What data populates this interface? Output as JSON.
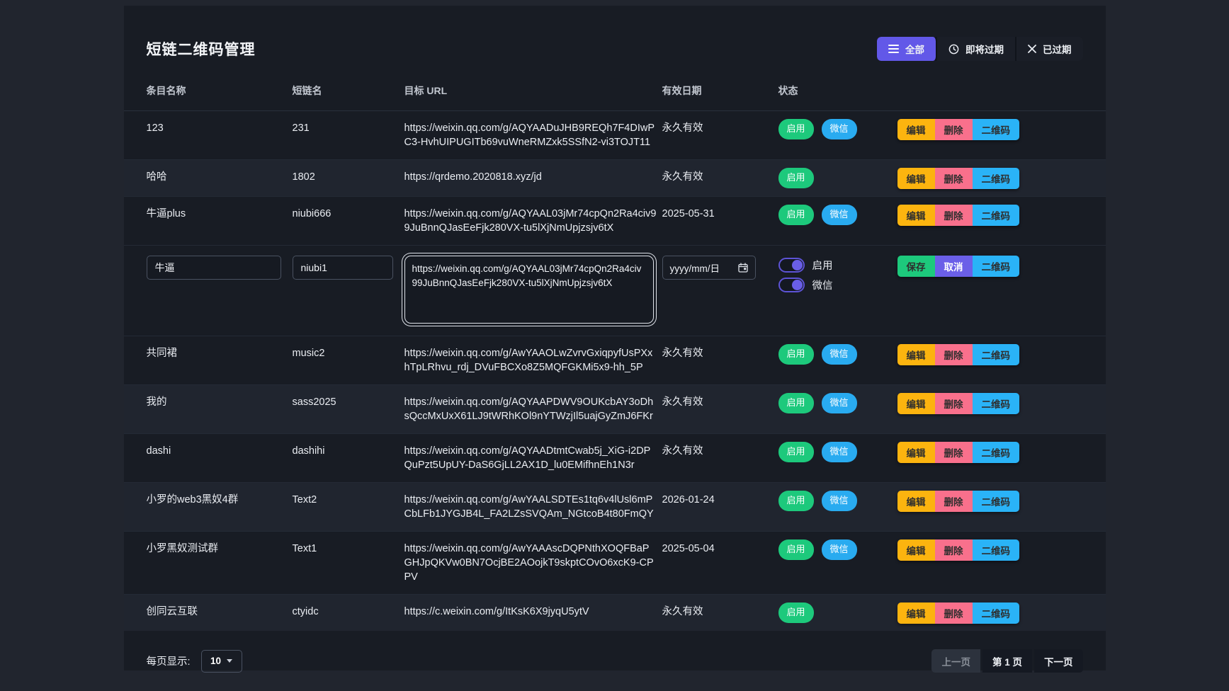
{
  "page": {
    "title": "短链二维码管理"
  },
  "colors": {
    "accent_purple": "#6258e8",
    "success_green": "#1dc97c",
    "info_blue": "#29abf0",
    "warning_amber": "#fcb40f",
    "danger_pink": "#f9708c",
    "panel_bg": "#181c24",
    "stripe_bg": "#20252f"
  },
  "filters": [
    {
      "label": "全部",
      "icon": "list-icon",
      "active": true
    },
    {
      "label": "即将过期",
      "icon": "clock-icon",
      "active": false
    },
    {
      "label": "已过期",
      "icon": "x-icon",
      "active": false
    }
  ],
  "table": {
    "headers": [
      "条目名称",
      "短链名",
      "目标 URL",
      "有效日期",
      "状态"
    ],
    "status_labels": {
      "enabled": "启用",
      "wechat": "微信"
    },
    "row_actions": {
      "edit": "编辑",
      "delete": "删除",
      "qr": "二维码"
    },
    "rows": [
      {
        "name": "123",
        "slug": "231",
        "url": "https://weixin.qq.com/g/AQYAADuJHB9REQh7F4DIwPC3-HvhUIPUGITb69vuWneRMZxk5SSfN2-vi3TOJT11",
        "date": "永久有效",
        "enabled": true,
        "wechat": true
      },
      {
        "name": "哈哈",
        "slug": "1802",
        "url": "https://qrdemo.2020818.xyz/jd",
        "date": "永久有效",
        "enabled": true,
        "wechat": false
      },
      {
        "name": "牛逼plus",
        "slug": "niubi666",
        "url": "https://weixin.qq.com/g/AQYAAL03jMr74cpQn2Ra4civ99JuBnnQJasEeFjk280VX-tu5lXjNmUpjzsjv6tX",
        "date": "2025-05-31",
        "enabled": true,
        "wechat": true
      },
      {
        "name": "共同裙",
        "slug": "music2",
        "url": "https://weixin.qq.com/g/AwYAAOLwZvrvGxiqpyfUsPXxhTpLRhvu_rdj_DVuFBCXo8Z5MQFGKMi5x9-hh_5P",
        "date": "永久有效",
        "enabled": true,
        "wechat": true
      },
      {
        "name": "我的",
        "slug": "sass2025",
        "url": "https://weixin.qq.com/g/AQYAAPDWV9OUKcbAY3oDhsQccMxUxX61LJ9tWRhKOl9nYTWzjIl5uajGyZmJ6FKr",
        "date": "永久有效",
        "enabled": true,
        "wechat": true
      },
      {
        "name": "dashi",
        "slug": "dashihi",
        "url": "https://weixin.qq.com/g/AQYAADtmtCwab5j_XiG-i2DPQuPzt5UpUY-DaS6GjLL2AX1D_lu0EMifhnEh1N3r",
        "date": "永久有效",
        "enabled": true,
        "wechat": true
      },
      {
        "name": "小罗的web3黑奴4群",
        "slug": "Text2",
        "url": "https://weixin.qq.com/g/AwYAALSDTEs1tq6v4lUsl6mPCbLFb1JYGJB4L_FA2LZsSVQAm_NGtcoB4t80FmQY",
        "date": "2026-01-24",
        "enabled": true,
        "wechat": true
      },
      {
        "name": "小罗黑奴测试群",
        "slug": "Text1",
        "url": "https://weixin.qq.com/g/AwYAAAscDQPNthXOQFBaPGHJpQKVw0BN7OcjBE2AOojkT9skptCOvO6xcK9-CPPV",
        "date": "2025-05-04",
        "enabled": true,
        "wechat": true
      },
      {
        "name": "创同云互联",
        "slug": "ctyidc",
        "url": "https://c.weixin.com/g/ItKsK6X9jyqU5ytV",
        "date": "永久有效",
        "enabled": true,
        "wechat": false
      }
    ]
  },
  "edit_row": {
    "position": 3,
    "name_value": "牛逼",
    "slug_value": "niubi1",
    "url_value": "https://weixin.qq.com/g/AQYAAL03jMr74cpQn2Ra4civ99JuBnnQJasEeFjk280VX-tu5lXjNmUpjzsjv6tX",
    "date_placeholder": "yyyy/mm/日",
    "toggle_enable_label": "启用",
    "toggle_wechat_label": "微信",
    "save_label": "保存",
    "cancel_label": "取消",
    "qr_label": "二维码"
  },
  "pagination": {
    "per_page_label": "每页显示:",
    "per_page_value": "10",
    "prev_label": "上一页",
    "current_page_label": "第 1 页",
    "next_label": "下一页"
  }
}
